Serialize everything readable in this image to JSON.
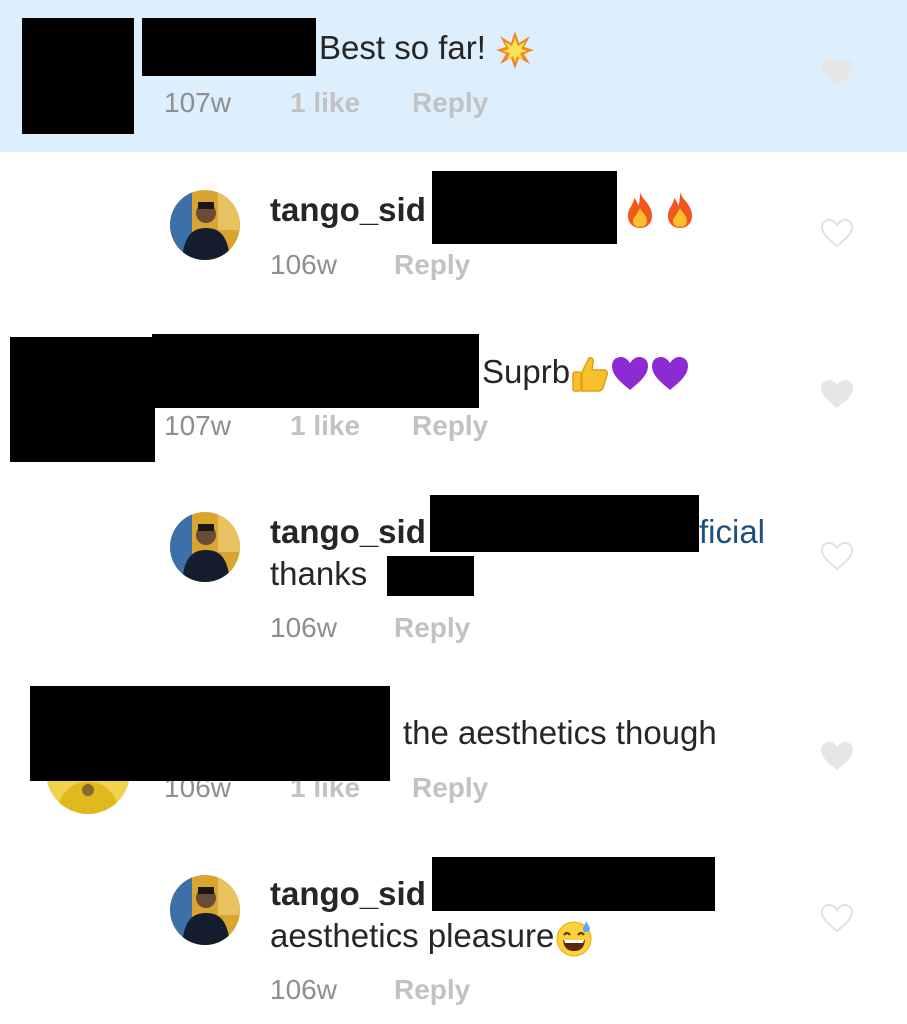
{
  "comments": [
    {
      "text": "Best so far!",
      "emoji": "collision-emoji",
      "time": "107w",
      "likes": "1 like",
      "reply": "Reply",
      "highlighted": true,
      "liked": true
    },
    {
      "username": "tango_sid",
      "emoji": "fire-emoji fire-emoji",
      "time": "106w",
      "reply": "Reply",
      "liked": false
    },
    {
      "text": "Suprb",
      "emoji": "thumbs-up-emoji purple-heart-emoji purple-heart-emoji",
      "time": "107w",
      "likes": "1 like",
      "reply": "Reply",
      "liked": true
    },
    {
      "username": "tango_sid",
      "mention_suffix": "ficial",
      "text": "thanks",
      "time": "106w",
      "reply": "Reply",
      "liked": false
    },
    {
      "text": "the aesthetics though",
      "time": "106w",
      "likes": "1 like",
      "reply": "Reply",
      "liked": true
    },
    {
      "username": "tango_sid",
      "text": "aesthetics pleasure",
      "emoji": "grinning-sweat-emoji",
      "time": "106w",
      "reply": "Reply",
      "liked": false
    }
  ],
  "colors": {
    "highlight_band": "#ddeefc",
    "mention_link": "#1f4f80",
    "meta_text": "#8e8e8e"
  }
}
